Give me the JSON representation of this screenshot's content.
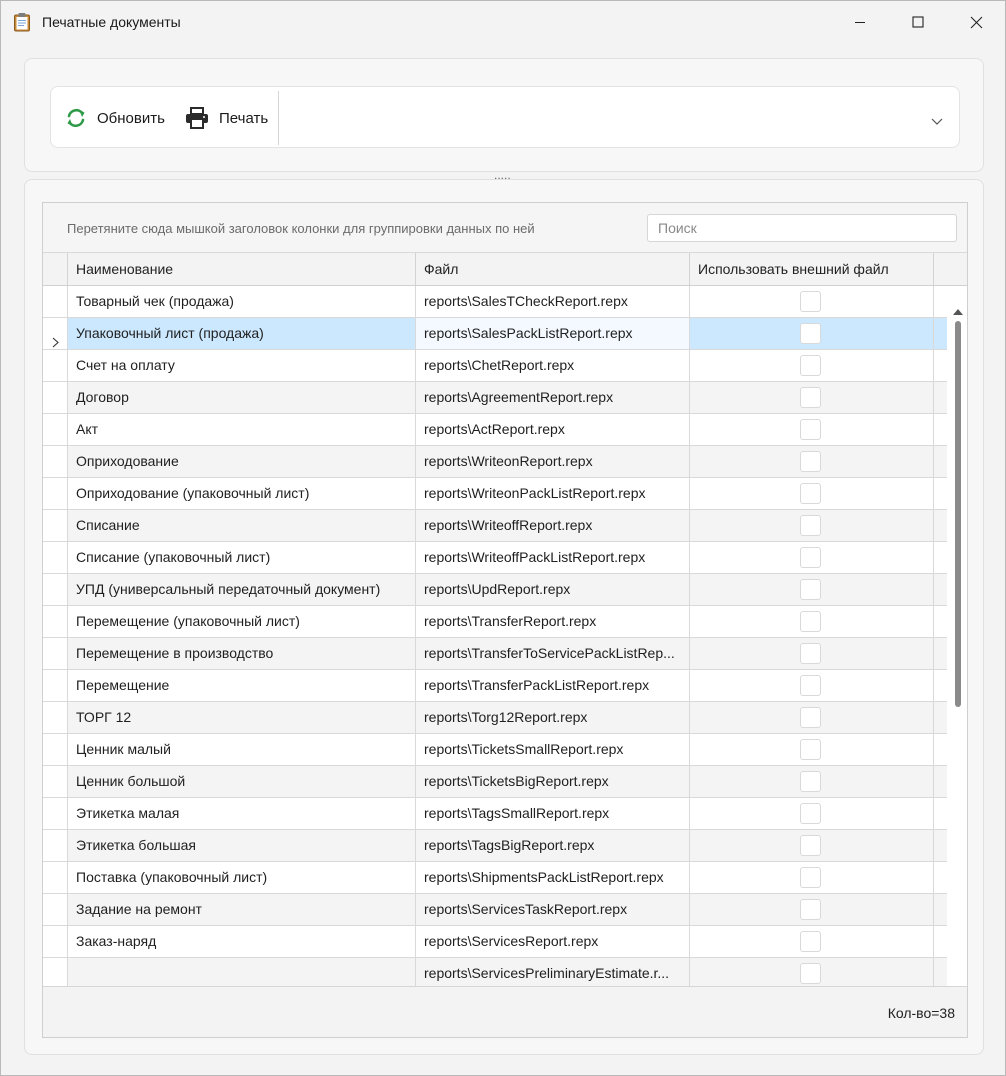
{
  "window": {
    "title": "Печатные документы"
  },
  "toolbar": {
    "refresh_label": "Обновить",
    "print_label": "Печать"
  },
  "grid": {
    "group_hint": "Перетяните сюда мышкой заголовок колонки для группировки данных по ней",
    "search_placeholder": "Поиск",
    "columns": {
      "name": "Наименование",
      "file": "Файл",
      "external": "Использовать внешний файл"
    },
    "selected_index": 1,
    "rows": [
      {
        "name": "Товарный чек (продажа)",
        "file": "reports\\SalesTCheckReport.repx",
        "external": false
      },
      {
        "name": "Упаковочный лист (продажа)",
        "file": "reports\\SalesPackListReport.repx",
        "external": false
      },
      {
        "name": "Счет на оплату",
        "file": "reports\\ChetReport.repx",
        "external": false
      },
      {
        "name": "Договор",
        "file": "reports\\AgreementReport.repx",
        "external": false
      },
      {
        "name": "Акт",
        "file": "reports\\ActReport.repx",
        "external": false
      },
      {
        "name": "Оприходование",
        "file": "reports\\WriteonReport.repx",
        "external": false
      },
      {
        "name": "Оприходование (упаковочный лист)",
        "file": "reports\\WriteonPackListReport.repx",
        "external": false
      },
      {
        "name": "Списание",
        "file": "reports\\WriteoffReport.repx",
        "external": false
      },
      {
        "name": "Списание (упаковочный лист)",
        "file": "reports\\WriteoffPackListReport.repx",
        "external": false
      },
      {
        "name": "УПД (универсальный передаточный документ)",
        "file": "reports\\UpdReport.repx",
        "external": false
      },
      {
        "name": "Перемещение (упаковочный лист)",
        "file": "reports\\TransferReport.repx",
        "external": false
      },
      {
        "name": "Перемещение в производство",
        "file": "reports\\TransferToServicePackListRep...",
        "external": false
      },
      {
        "name": "Перемещение",
        "file": "reports\\TransferPackListReport.repx",
        "external": false
      },
      {
        "name": "ТОРГ 12",
        "file": "reports\\Torg12Report.repx",
        "external": false
      },
      {
        "name": "Ценник малый",
        "file": "reports\\TicketsSmallReport.repx",
        "external": false
      },
      {
        "name": "Ценник большой",
        "file": "reports\\TicketsBigReport.repx",
        "external": false
      },
      {
        "name": "Этикетка малая",
        "file": "reports\\TagsSmallReport.repx",
        "external": false
      },
      {
        "name": "Этикетка большая",
        "file": "reports\\TagsBigReport.repx",
        "external": false
      },
      {
        "name": "Поставка (упаковочный лист)",
        "file": "reports\\ShipmentsPackListReport.repx",
        "external": false
      },
      {
        "name": "Задание на ремонт",
        "file": "reports\\ServicesTaskReport.repx",
        "external": false
      },
      {
        "name": "Заказ-наряд",
        "file": "reports\\ServicesReport.repx",
        "external": false
      },
      {
        "name": "",
        "file": "reports\\ServicesPreliminaryEstimate.r...",
        "external": false
      }
    ],
    "count_label": "Кол-во=38"
  },
  "colors": {
    "selection": "#cce8ff",
    "refresh_icon": "#2e9a48",
    "print_icon": "#2b2b2b"
  }
}
